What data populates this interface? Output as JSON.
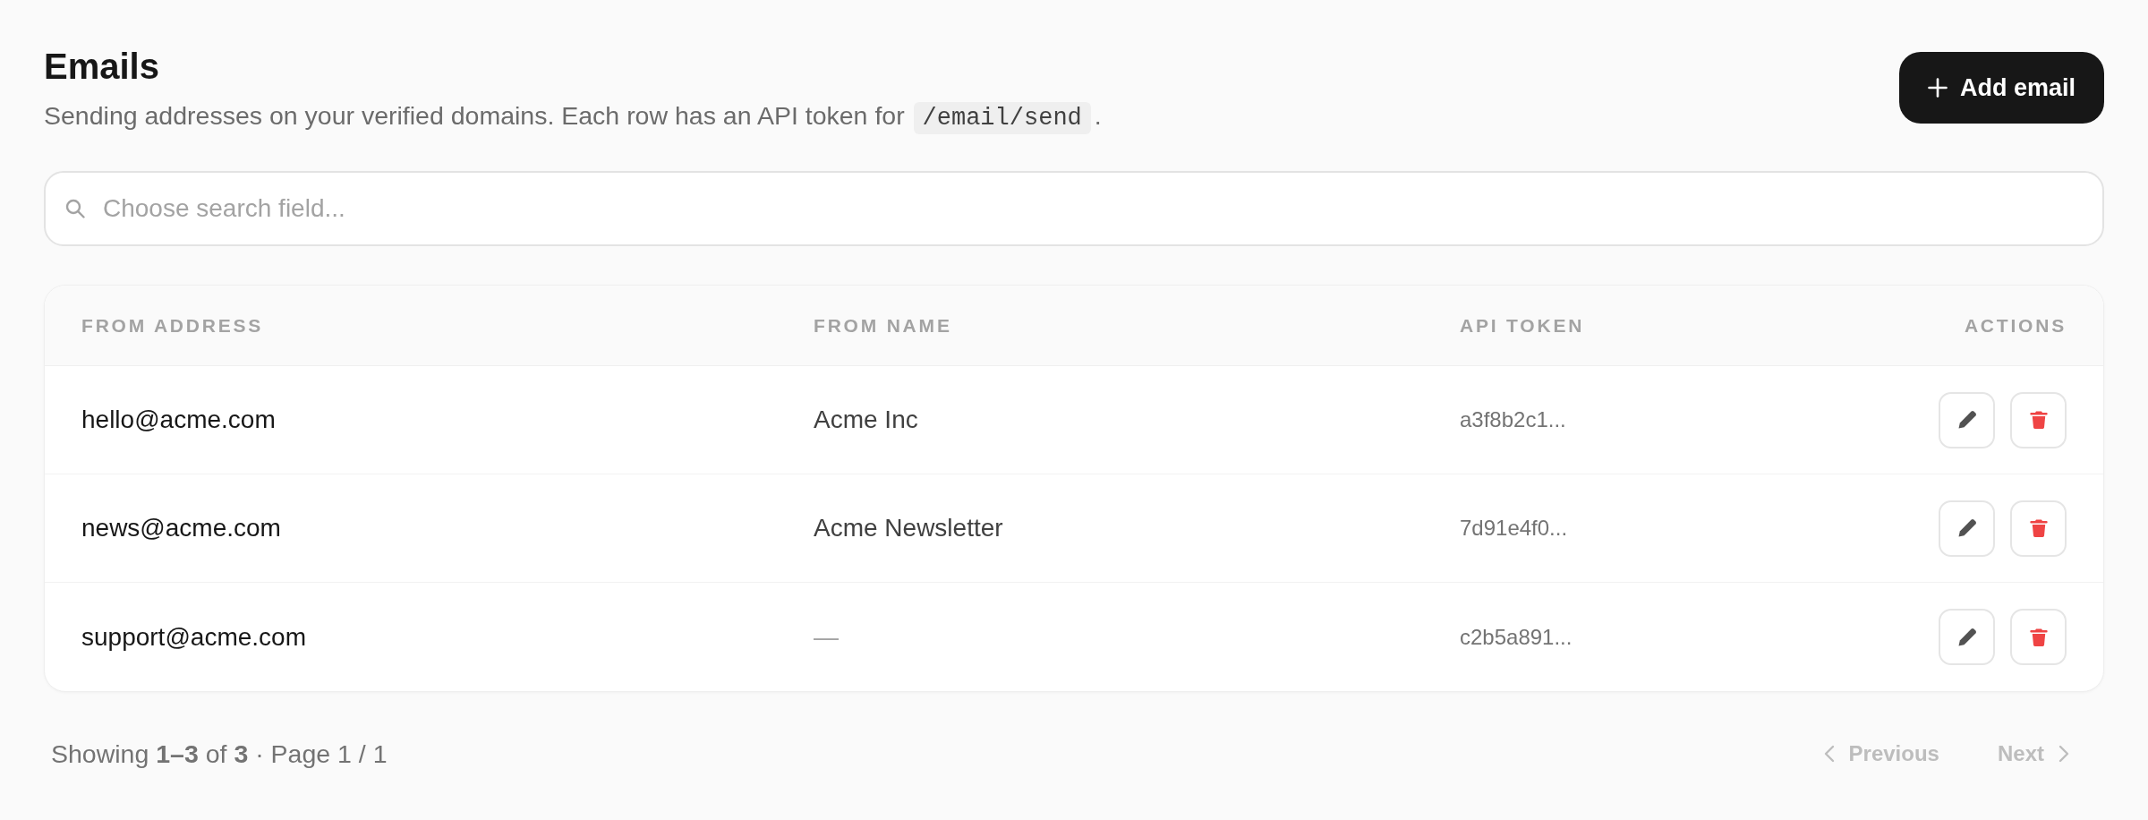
{
  "header": {
    "title": "Emails",
    "subtitle": {
      "text": "Sending addresses on your verified domains. Each row has an API token for",
      "code": "/email/send",
      "end": "."
    },
    "add_button": {
      "label": "Add email"
    }
  },
  "search": {
    "placeholder": "Choose search field..."
  },
  "table": {
    "columns": [
      "FROM ADDRESS",
      "FROM NAME",
      "API TOKEN",
      "ACTIONS"
    ],
    "rows": [
      {
        "from_address": "hello@acme.com",
        "from_name": "Acme Inc",
        "from_name_empty": false,
        "api_token": "a3f8b2c1..."
      },
      {
        "from_address": "news@acme.com",
        "from_name": "Acme Newsletter",
        "from_name_empty": false,
        "api_token": "7d91e4f0..."
      },
      {
        "from_address": "support@acme.com",
        "from_name": "—",
        "from_name_empty": true,
        "api_token": "c2b5a891..."
      }
    ]
  },
  "pagination": {
    "summary": "Showing **1–3** of **3** · Page 1 / 1",
    "previous": {
      "label": "Previous",
      "disabled": true
    },
    "next": {
      "label": "Next",
      "disabled": true
    }
  }
}
